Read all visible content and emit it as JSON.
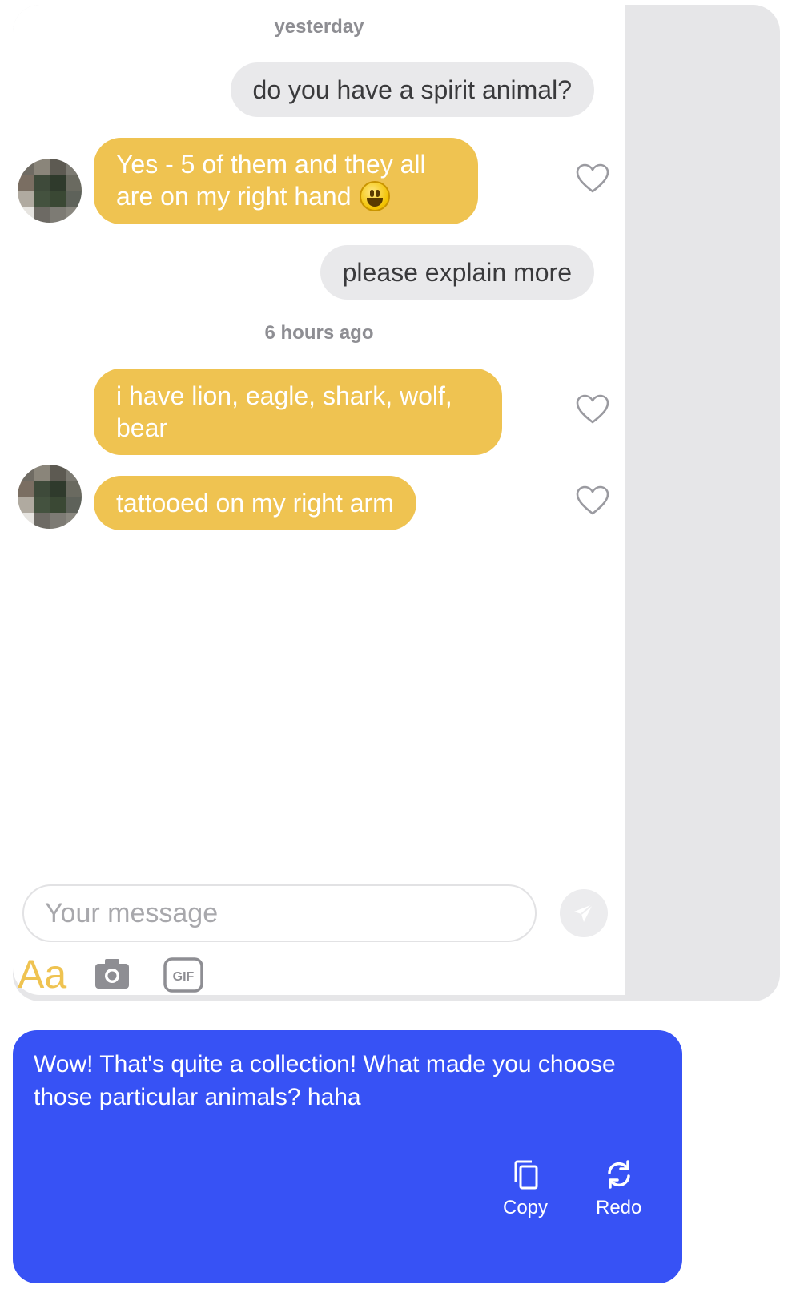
{
  "chat": {
    "timestamps": [
      "yesterday",
      "6 hours ago"
    ],
    "messages": [
      {
        "direction": "outgoing",
        "text": "do you have a spirit animal?"
      },
      {
        "direction": "incoming",
        "text": "Yes - 5 of them and they all are on my right hand",
        "emoji": "grinning-face"
      },
      {
        "direction": "outgoing",
        "text": "please explain more"
      },
      {
        "direction": "incoming",
        "text": "i have lion, eagle, shark, wolf, bear"
      },
      {
        "direction": "incoming",
        "text": "tattooed on my right arm"
      }
    ]
  },
  "composer": {
    "placeholder": "Your message",
    "text_format_label": "Aa",
    "tools": [
      "camera-icon",
      "gif-icon"
    ],
    "send_icon": "paper-plane-icon"
  },
  "suggestion": {
    "text": "Wow! That's quite a collection! What made you choose those particular animals? haha",
    "copy_label": "Copy",
    "redo_label": "Redo"
  },
  "colors": {
    "incoming_bubble": "#efc351",
    "outgoing_bubble": "#e9e9eb",
    "suggestion_bg": "#3752f5",
    "accent": "#efc351"
  }
}
